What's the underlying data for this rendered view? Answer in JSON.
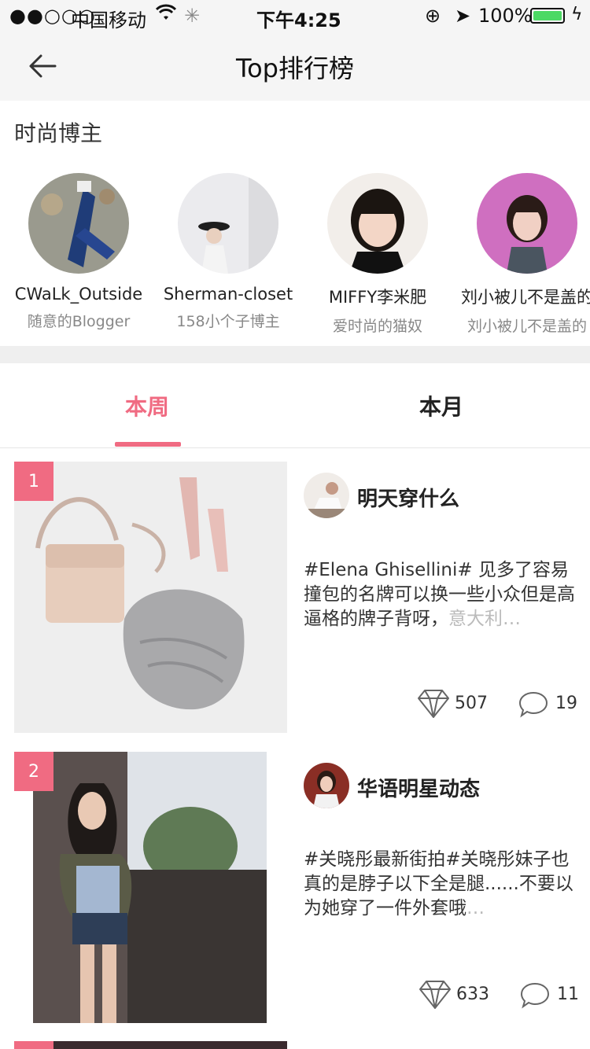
{
  "status_bar": {
    "signal_dots": "●●○○○",
    "carrier": "中国移动",
    "time": "下午4:25",
    "battery_pct": "100%"
  },
  "nav": {
    "title": "Top排行榜"
  },
  "bloggers": {
    "title": "时尚博主",
    "items": [
      {
        "name": "CWaLk_Outside",
        "desc": "随意的Blogger"
      },
      {
        "name": "Sherman-closet",
        "desc": "158小个子博主"
      },
      {
        "name": "MIFFY李米肥",
        "desc": "爱时尚的猫奴"
      },
      {
        "name": "刘小被儿不是盖的",
        "desc": "刘小被儿不是盖的"
      }
    ]
  },
  "tabs": [
    {
      "label": "本周"
    },
    {
      "label": "本月"
    }
  ],
  "accent_color": "#f06b82",
  "posts": [
    {
      "rank": "1",
      "author": "明天穿什么",
      "text_main": "#Elena Ghisellini# 见多了容易撞包的名牌可以换一些小众但是高逼格的牌子背呀，",
      "text_fade": "意大利…",
      "likes": "507",
      "comments": "19"
    },
    {
      "rank": "2",
      "author": "华语明星动态",
      "text_main": "#关晓彤最新街拍#关晓彤妹子也真的是脖子以下全是腿......不要以为她穿了一件外套哦",
      "text_fade": "…",
      "likes": "633",
      "comments": "11"
    }
  ]
}
